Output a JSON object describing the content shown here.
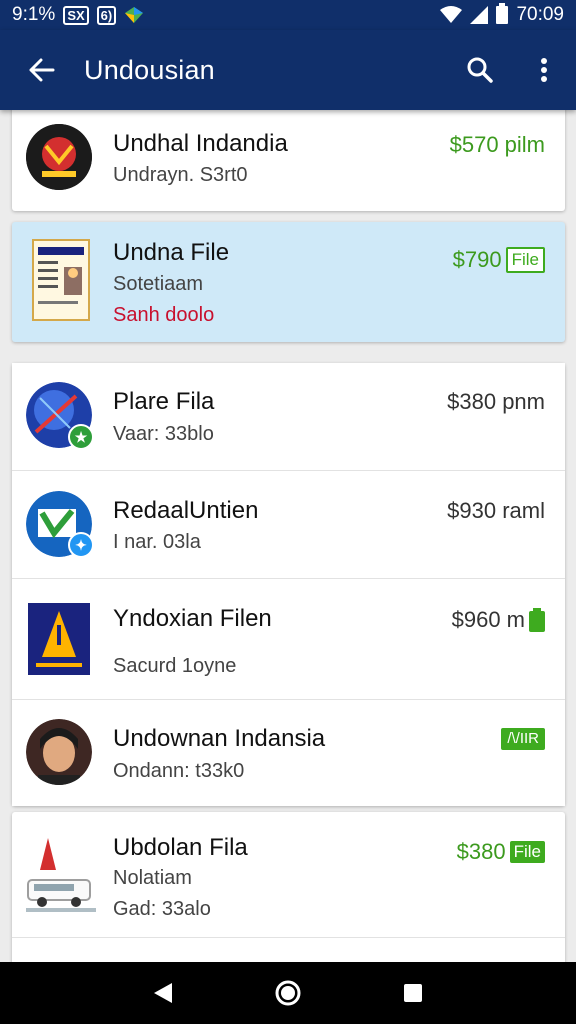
{
  "status_bar": {
    "time_left": "9:1%",
    "box_icon_text": "SX",
    "box_icon_text_2": "6)",
    "time": "70:09"
  },
  "app_bar": {
    "title": "Undousian"
  },
  "items": [
    {
      "title": "Undhal Indandia",
      "subtitle": "Undrayn. S3rt0",
      "price": "$570 pilm"
    },
    {
      "title": "Undna File",
      "subtitle": "Sotetiaam",
      "subtitle2": "Sanh doolo",
      "price": "$790",
      "tag": "File"
    },
    {
      "title": "Plare Fila",
      "subtitle": "Vaar: 33blo",
      "price": "$380 pnm"
    },
    {
      "title": "RedaalUntien",
      "subtitle": "I nar. 03la",
      "price": "$930 raml"
    },
    {
      "title": "Yndoxian Filen",
      "subtitle": "Sacurd 1oyne",
      "price": "$960 m"
    },
    {
      "title": "Undownan Indansia",
      "subtitle": "Ondann: t33k0",
      "tag": "/\\/IIR"
    },
    {
      "title": "Ubdolan Fila",
      "subtitle": "Nolatiam",
      "subtitle2": "Gad: 33alo",
      "price": "$380",
      "tag": "File"
    }
  ],
  "colors": {
    "app_bar": "#102f6a",
    "price_green": "#3c9a1e",
    "selected_row": "#cfe9f8",
    "alert_red": "#c8102e"
  }
}
